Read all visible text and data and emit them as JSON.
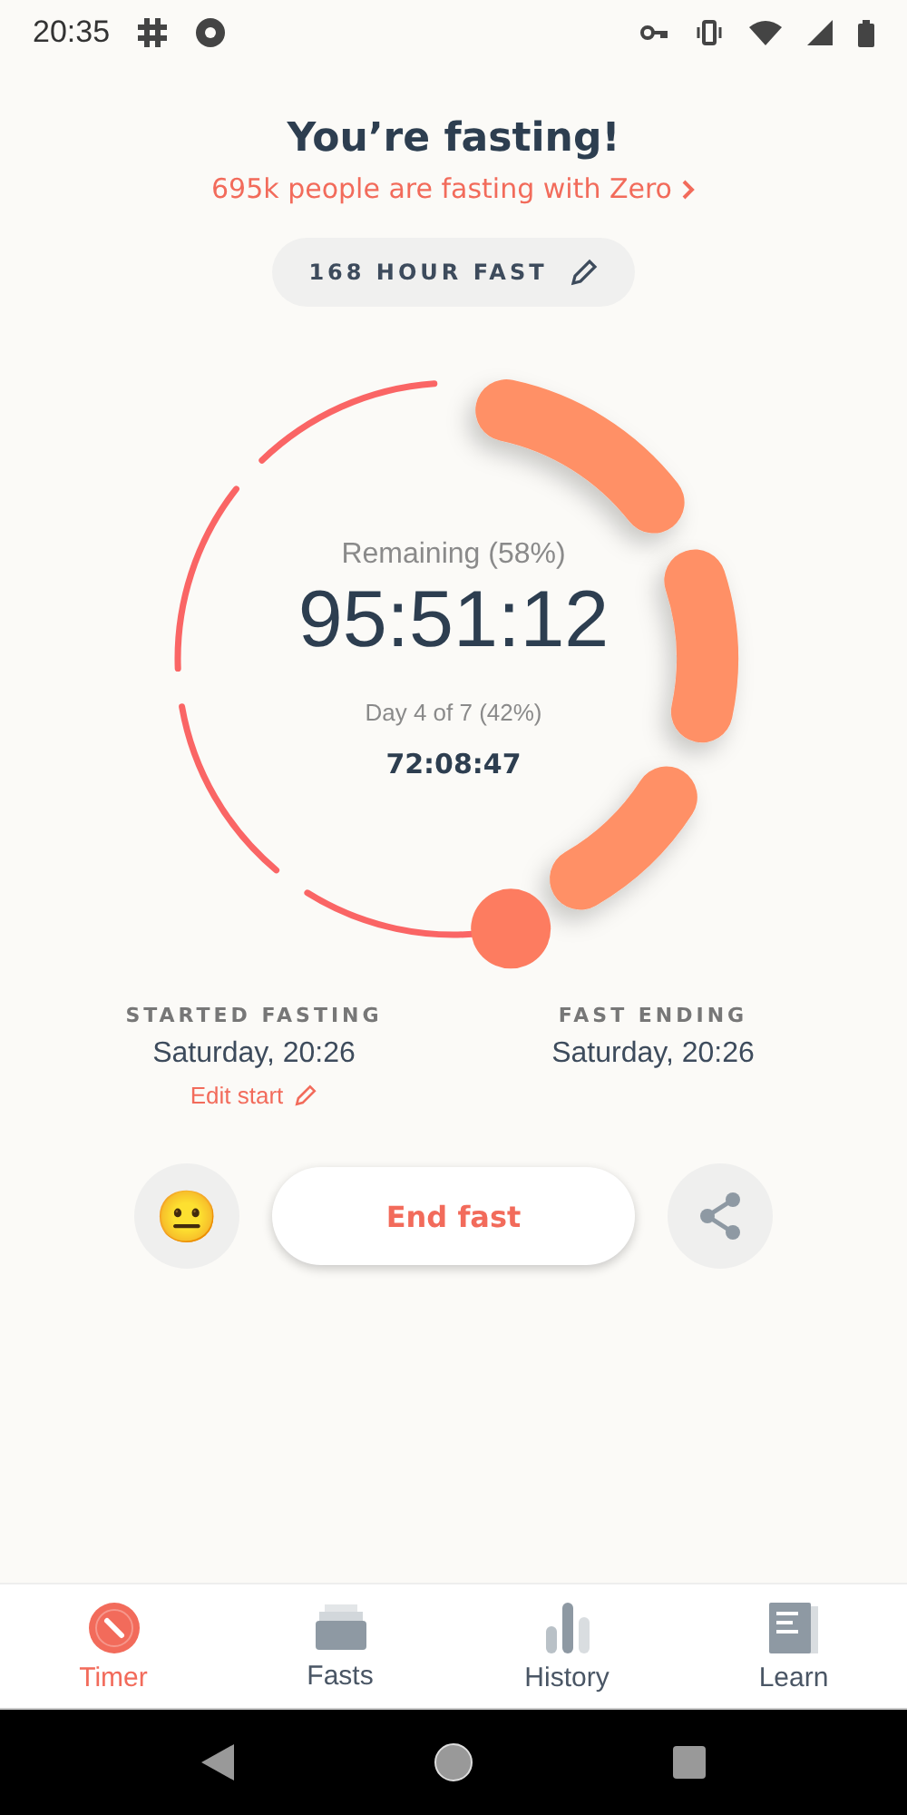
{
  "status_bar": {
    "time": "20:35"
  },
  "header": {
    "title": "You’re fasting!",
    "community_link": "695k people are fasting with Zero"
  },
  "fast_type": {
    "label": "168 HOUR FAST"
  },
  "timer": {
    "caption": "Remaining (58%)",
    "remaining": "95:51:12",
    "day_caption": "Day 4 of 7 (42%)",
    "elapsed": "72:08:47"
  },
  "times": [
    {
      "label": "STARTED FASTING",
      "value": "Saturday, 20:26",
      "action": "Edit start"
    },
    {
      "label": "FAST ENDING",
      "value": "Saturday, 20:26"
    }
  ],
  "actions": {
    "mood": "😐",
    "end_button": "End fast"
  },
  "tabs": [
    {
      "label": "Timer",
      "kind": "timer",
      "selected": true
    },
    {
      "label": "Fasts",
      "kind": "fasts",
      "selected": false
    },
    {
      "label": "History",
      "kind": "history",
      "selected": false
    },
    {
      "label": "Learn",
      "kind": "learn",
      "selected": false
    }
  ]
}
